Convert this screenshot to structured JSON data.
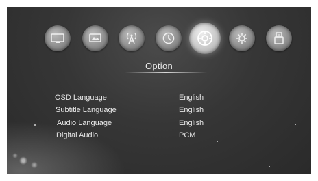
{
  "menu": {
    "icons": [
      {
        "name": "picture-icon"
      },
      {
        "name": "display-icon"
      },
      {
        "name": "channel-search-icon"
      },
      {
        "name": "time-icon"
      },
      {
        "name": "option-icon",
        "selected": true
      },
      {
        "name": "system-icon"
      },
      {
        "name": "usb-icon"
      }
    ],
    "title": "Option"
  },
  "settings": [
    {
      "label": "OSD Language",
      "value": "English"
    },
    {
      "label": "Subtitle Language",
      "value": "English"
    },
    {
      "label": "Audio Language",
      "value": "English"
    },
    {
      "label": "Digital Audio",
      "value": "PCM"
    }
  ]
}
